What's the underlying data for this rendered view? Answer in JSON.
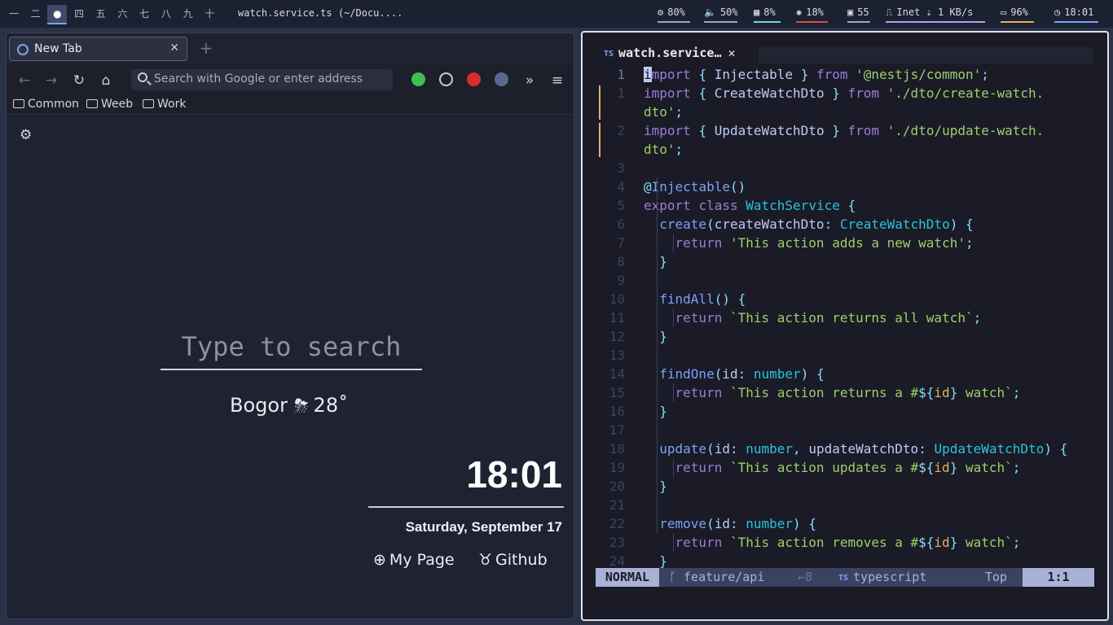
{
  "topbar": {
    "workspaces": [
      "一",
      "二",
      "●",
      "四",
      "五",
      "六",
      "七",
      "八",
      "九",
      "十"
    ],
    "active_workspace_index": 2,
    "window_title": "watch.service.ts (~/Docu....",
    "stats": [
      {
        "icon": "cpu-icon",
        "value": "80%",
        "color": "#9aa5ce"
      },
      {
        "icon": "volume-icon",
        "value": "50%",
        "color": "#9aa5ce"
      },
      {
        "icon": "memory-icon",
        "value": "8%",
        "color": "#73daca"
      },
      {
        "icon": "temperature-icon",
        "value": "18%",
        "color": "#db4b4b"
      },
      {
        "icon": "disk-icon",
        "value": "55",
        "color": "#9aa5ce"
      },
      {
        "icon": "network-icon",
        "value": "Inet ⇣ 1 KB/s",
        "color": "#bb9af7"
      },
      {
        "icon": "battery-icon",
        "value": "96%",
        "color": "#e0af68"
      },
      {
        "icon": "clock-icon",
        "value": "18:01",
        "color": "#7aa2f7"
      }
    ]
  },
  "browser": {
    "tab_title": "New Tab",
    "url_placeholder": "Search with Google or enter address",
    "bookmarks": [
      "Common",
      "Weeb",
      "Work"
    ],
    "startpage": {
      "search_placeholder": "Type to search",
      "weather_city": "Bogor",
      "weather_temp": "28˚",
      "clock": "18:01",
      "date": "Saturday, September 17",
      "links": [
        "My Page",
        "Github"
      ]
    }
  },
  "editor": {
    "tab_title": "watch.service…",
    "lines": [
      {
        "num": "1",
        "html": "<span class=\"cursor\">i</span><span class=\"kw\">mport</span> <span class=\"pun\">{</span> Injectable <span class=\"pun\">}</span> <span class=\"kw\">from</span> <span class=\"str\">'@nestjs/common'</span><span class=\"pun\">;</span>"
      },
      {
        "num": "1",
        "html": "<span class=\"kw\">import</span> <span class=\"pun\">{</span> CreateWatchDto <span class=\"pun\">}</span> <span class=\"kw\">from</span> <span class=\"str\">'./dto/create-watch.</span>"
      },
      {
        "num": "",
        "html": "<span class=\"str\">dto'</span><span class=\"pun\">;</span>"
      },
      {
        "num": "2",
        "html": "<span class=\"kw\">import</span> <span class=\"pun\">{</span> UpdateWatchDto <span class=\"pun\">}</span> <span class=\"kw\">from</span> <span class=\"str\">'./dto/update-watch.</span>"
      },
      {
        "num": "",
        "html": "<span class=\"str\">dto'</span><span class=\"pun\">;</span>"
      },
      {
        "num": "3",
        "html": ""
      },
      {
        "num": "4",
        "html": "<span class=\"pun\">@</span><span class=\"fn\">Injectable</span><span class=\"pun\">()</span>"
      },
      {
        "num": "5",
        "html": "<span class=\"kw\">export</span> <span class=\"kw\">class</span> <span class=\"typ\">WatchService</span> <span class=\"pun\">{</span>"
      },
      {
        "num": "6",
        "html": "  <span class=\"fn\">create</span><span class=\"pun\">(</span>createWatchDto<span class=\"pun\">:</span> <span class=\"typ\">CreateWatchDto</span><span class=\"pun\">)</span> <span class=\"pun\">{</span>"
      },
      {
        "num": "7",
        "html": "    <span class=\"kw\">return</span> <span class=\"str\">'This action adds a new watch'</span><span class=\"pun\">;</span>"
      },
      {
        "num": "8",
        "html": "  <span class=\"pun\">}</span>"
      },
      {
        "num": "9",
        "html": ""
      },
      {
        "num": "10",
        "html": "  <span class=\"fn\">findAll</span><span class=\"pun\">()</span> <span class=\"pun\">{</span>"
      },
      {
        "num": "11",
        "html": "    <span class=\"kw\">return</span> <span class=\"str\">`This action returns all watch`</span><span class=\"pun\">;</span>"
      },
      {
        "num": "12",
        "html": "  <span class=\"pun\">}</span>"
      },
      {
        "num": "13",
        "html": ""
      },
      {
        "num": "14",
        "html": "  <span class=\"fn\">findOne</span><span class=\"pun\">(</span>id<span class=\"pun\">:</span> <span class=\"typ\">number</span><span class=\"pun\">)</span> <span class=\"pun\">{</span>"
      },
      {
        "num": "15",
        "html": "    <span class=\"kw\">return</span> <span class=\"str\">`This action returns a #</span><span class=\"pun\">${</span><span class=\"var\">id</span><span class=\"pun\">}</span><span class=\"str\"> watch`</span><span class=\"pun\">;</span>"
      },
      {
        "num": "16",
        "html": "  <span class=\"pun\">}</span>"
      },
      {
        "num": "17",
        "html": ""
      },
      {
        "num": "18",
        "html": "  <span class=\"fn\">update</span><span class=\"pun\">(</span>id<span class=\"pun\">:</span> <span class=\"typ\">number</span><span class=\"pun\">,</span> updateWatchDto<span class=\"pun\">:</span> <span class=\"typ\">UpdateWatchDto</span><span class=\"pun\">)</span> <span class=\"pun\">{</span>"
      },
      {
        "num": "19",
        "html": "    <span class=\"kw\">return</span> <span class=\"str\">`This action updates a #</span><span class=\"pun\">${</span><span class=\"var\">id</span><span class=\"pun\">}</span><span class=\"str\"> watch`</span><span class=\"pun\">;</span>"
      },
      {
        "num": "20",
        "html": "  <span class=\"pun\">}</span>"
      },
      {
        "num": "21",
        "html": ""
      },
      {
        "num": "22",
        "html": "  <span class=\"fn\">remove</span><span class=\"pun\">(</span>id<span class=\"pun\">:</span> <span class=\"typ\">number</span><span class=\"pun\">)</span> <span class=\"pun\">{</span>"
      },
      {
        "num": "23",
        "html": "    <span class=\"kw\">return</span> <span class=\"str\">`This action removes a #</span><span class=\"pun\">${</span><span class=\"var\">id</span><span class=\"pun\">}</span><span class=\"str\"> watch`</span><span class=\"pun\">;</span>"
      },
      {
        "num": "24",
        "html": "  <span class=\"pun\">}</span>"
      }
    ],
    "statusline": {
      "mode": "NORMAL",
      "branch": "feature/api",
      "diff": "←8",
      "filetype": "typescript",
      "scroll": "Top",
      "position": "1:1"
    }
  }
}
